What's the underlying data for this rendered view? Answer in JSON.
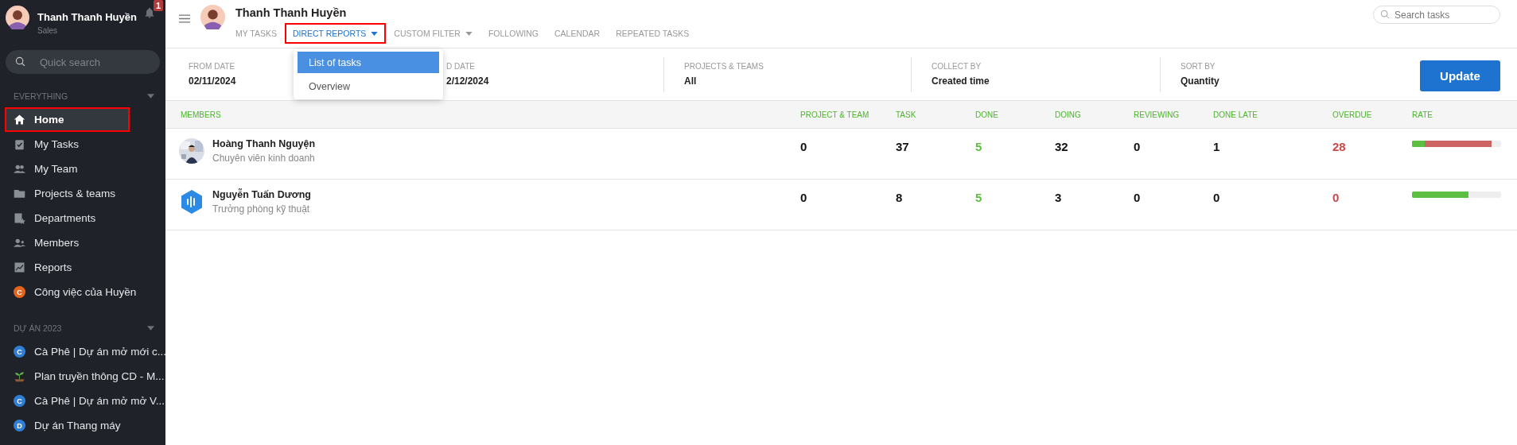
{
  "sidebar": {
    "user": {
      "name": "Thanh Thanh Huyền",
      "role": "Sales"
    },
    "notifications": {
      "count": "1"
    },
    "search": {
      "placeholder": "Quick search"
    },
    "sections": [
      {
        "title": "EVERYTHING",
        "items": [
          {
            "label": "Home",
            "kind": "home",
            "selected": true,
            "highlighted": true
          },
          {
            "label": "My Tasks",
            "kind": "tasks",
            "selected": false,
            "highlighted": false
          },
          {
            "label": "My Team",
            "kind": "team",
            "selected": false,
            "highlighted": false
          },
          {
            "label": "Projects & teams",
            "kind": "folder",
            "selected": false,
            "highlighted": false
          },
          {
            "label": "Departments",
            "kind": "department",
            "selected": false,
            "highlighted": false
          },
          {
            "label": "Members",
            "kind": "members",
            "selected": false,
            "highlighted": false
          },
          {
            "label": "Reports",
            "kind": "reports",
            "selected": false,
            "highlighted": false
          },
          {
            "label": "Công việc của Huyền",
            "kind": "letter",
            "letter": "C",
            "color": "#e8641c",
            "selected": false,
            "highlighted": false
          }
        ]
      },
      {
        "title": "DỰ ÁN 2023",
        "items": [
          {
            "label": "Cà Phê | Dự án mở mới c...",
            "kind": "letter",
            "letter": "C",
            "color": "#2f7fd6",
            "selected": false,
            "highlighted": false
          },
          {
            "label": "Plan truyền thông CD - M...",
            "kind": "plant",
            "selected": false,
            "highlighted": false
          },
          {
            "label": "Cà Phê | Dự án mở mở V...",
            "kind": "letter",
            "letter": "C",
            "color": "#2f7fd6",
            "selected": false,
            "highlighted": false
          },
          {
            "label": "Dự án Thang máy",
            "kind": "letter",
            "letter": "D",
            "color": "#2f7fd6",
            "selected": false,
            "highlighted": false
          }
        ]
      }
    ]
  },
  "header": {
    "user_name": "Thanh Thanh Huyền",
    "tabs": [
      {
        "label": "MY TASKS",
        "selected": false,
        "dropdown": false,
        "highlighted": false
      },
      {
        "label": "DIRECT REPORTS",
        "selected": true,
        "dropdown": true,
        "highlighted": true
      },
      {
        "label": "CUSTOM FILTER",
        "selected": false,
        "dropdown": true,
        "highlighted": false
      },
      {
        "label": "FOLLOWING",
        "selected": false,
        "dropdown": false,
        "highlighted": false
      },
      {
        "label": "CALENDAR",
        "selected": false,
        "dropdown": false,
        "highlighted": false
      },
      {
        "label": "REPEATED TASKS",
        "selected": false,
        "dropdown": false,
        "highlighted": false
      }
    ],
    "search": {
      "placeholder": "Search tasks"
    }
  },
  "dropdown_menu": {
    "items": [
      {
        "label": "List of tasks",
        "selected": true
      },
      {
        "label": "Overview",
        "selected": false
      }
    ]
  },
  "filters": [
    {
      "label": "FROM DATE",
      "value": "02/11/2024"
    },
    {
      "label": "D DATE",
      "value": "2/12/2024"
    },
    {
      "label": "PROJECTS & TEAMS",
      "value": "All"
    },
    {
      "label": "COLLECT BY",
      "value": "Created time"
    },
    {
      "label": "SORT BY",
      "value": "Quantity"
    }
  ],
  "update_button": "Update",
  "table": {
    "members_header": "MEMBERS",
    "columns": [
      "PROJECT & TEAM",
      "TASK",
      "DONE",
      "DOING",
      "REVIEWING",
      "DONE LATE",
      "OVERDUE",
      "RATE"
    ],
    "rows": [
      {
        "name": "Hoàng Thanh Nguyện",
        "title": "Chuyên viên kinh doanh",
        "cells": [
          "0",
          "37",
          "5",
          "32",
          "0",
          "1",
          "28"
        ],
        "rate": [
          {
            "kind": "done",
            "level": 0.14
          },
          {
            "kind": "overdue",
            "level": 0.89
          }
        ]
      },
      {
        "name": "Nguyễn Tuấn Dương",
        "title": "Trưởng phòng kỹ thuật",
        "kind": "logo",
        "cells": [
          "0",
          "8",
          "5",
          "3",
          "0",
          "0",
          "0"
        ],
        "rate": [
          {
            "kind": "done",
            "level": 0.63
          }
        ]
      }
    ]
  }
}
